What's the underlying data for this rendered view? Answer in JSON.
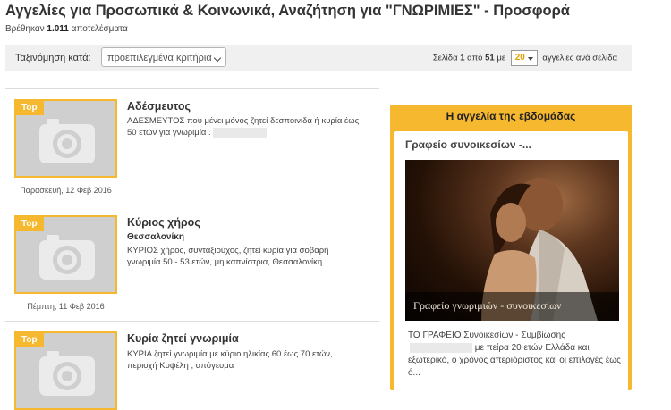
{
  "header": {
    "title": "Αγγελίες για Προσωπικά & Κοινωνικά, Αναζήτηση για \"ΓΝΩΡΙΜΙΕΣ\" - Προσφορά",
    "results_prefix": "Βρέθηκαν",
    "results_count": "1.011",
    "results_suffix": "αποτελέσματα"
  },
  "toolbar": {
    "sort_label": "Ταξινόμηση κατά:",
    "sort_value": "προεπιλεγμένα κριτήρια",
    "pager": {
      "page_word": "Σελίδα",
      "current_page": "1",
      "of_word": "από",
      "total_pages": "51",
      "with_word": "με",
      "per_page": "20",
      "per_page_suffix": "αγγελίες ανά σελίδα"
    }
  },
  "listings": [
    {
      "badge": "Top",
      "title": "Αδέσμευτος",
      "location": "",
      "description": "ΑΔΕΣΜΕΥΤΟΣ που μένει μόνος ζητεί δεσποινίδα ή κυρία έως 50 ετών για γνωριμία .",
      "date": "Παρασκευή, 12 Φεβ 2016"
    },
    {
      "badge": "Top",
      "title": "Κύριος χήρος",
      "location": "Θεσσαλονίκη",
      "description": "ΚΥΡΙΟΣ χήρος, συνταξιούχος, ζητεί κυρία για σοβαρή γνωριμία 50 - 53 ετών, μη καπνίστρια, Θεσσαλονίκη",
      "date": "Πέμπτη, 11 Φεβ 2016"
    },
    {
      "badge": "Top",
      "title": "Κυρία ζητεί γνωριμία",
      "location": "",
      "description": "ΚΥΡΙΑ ζητεί γνωριμία με κύριο ηλικίας 60 έως 70 ετών, περιοχή Κυψέλη , απόγευμα",
      "date": ""
    }
  ],
  "week_ad": {
    "header": "Η αγγελία της εβδομάδας",
    "title": "Γραφείο συνοικεσίων -...",
    "photo_caption": "Γραφείο γνωριμιών - συνοικεσίων",
    "desc_part1": "ΤΟ ΓΡΑΦΕΙΟ Συνοικεσίων - Συμβίωσης",
    "desc_part2": "με πείρα 20 ετών Ελλάδα και εξωτερικό, ο χρόνος απεριόριστος και οι επιλογές έως ό..."
  },
  "icons": {
    "thumbnail": "camera-icon",
    "sort_dropdown": "chevron-down-icon",
    "per_page_dropdown": "caret-down-icon"
  },
  "colors": {
    "accent": "#f5b82e",
    "toolbar_bg": "#f0f0f0",
    "per_page_text": "#e0a000"
  }
}
